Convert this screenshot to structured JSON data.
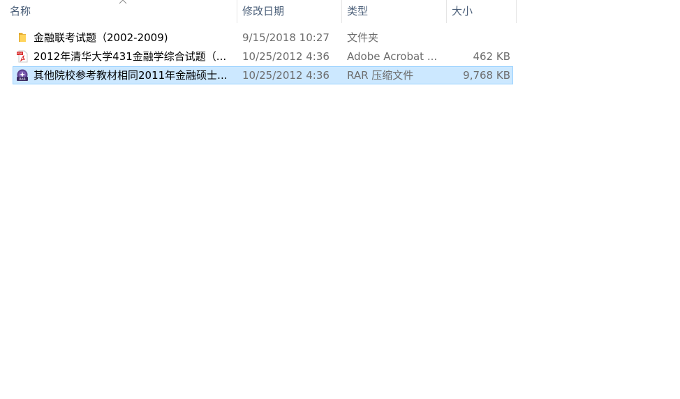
{
  "columns": {
    "name": "名称",
    "date": "修改日期",
    "type": "类型",
    "size": "大小"
  },
  "files": [
    {
      "icon": "folder-icon",
      "name": "金融联考试题（2002-2009)",
      "date": "9/15/2018 10:27",
      "type": "文件夹",
      "size": "",
      "selected": false
    },
    {
      "icon": "pdf-icon",
      "name": "2012年清华大学431金融学综合试题（...",
      "date": "10/25/2012 4:36",
      "type": "Adobe Acrobat ...",
      "size": "462 KB",
      "selected": false
    },
    {
      "icon": "rar-archive-icon",
      "name": "其他院校参考教材相同2011年金融硕士...",
      "date": "10/25/2012 4:36",
      "type": "RAR 压缩文件",
      "size": "9,768 KB",
      "selected": true
    }
  ],
  "colors": {
    "selection_bg": "#cce8ff",
    "selection_border": "#99d1ff",
    "header_text": "#4c607a",
    "secondary_text": "#6d6d6d"
  }
}
